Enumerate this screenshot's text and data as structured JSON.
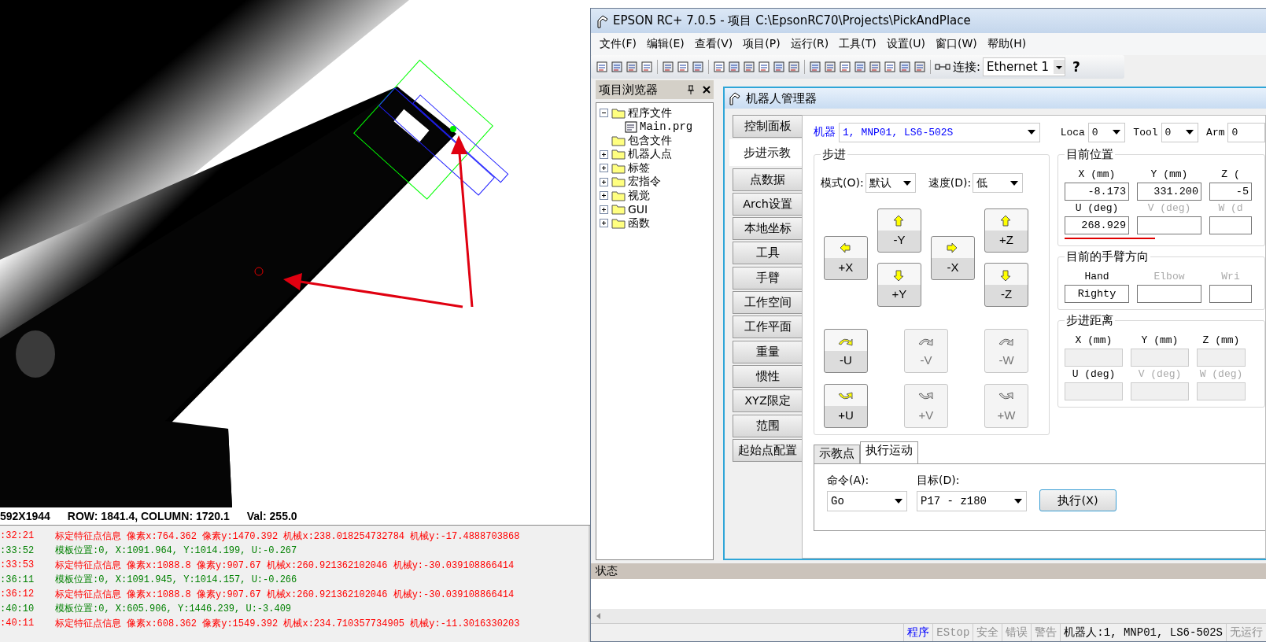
{
  "camera_view": {
    "info": [
      "592X1944",
      "ROW: 1841.4, COLUMN: 1720.1",
      "Val: 255.0"
    ]
  },
  "log": [
    {
      "time": ":32:21",
      "text": "标定特征点信息 像素x:764.362 像素y:1470.392 机械x:238.018254732784 机械y:-17.4888703868",
      "color": "#ff0000"
    },
    {
      "time": ":33:52",
      "text": "模板位置:0, X:1091.964, Y:1014.199, U:-0.267",
      "color": "#008000"
    },
    {
      "time": ":33:53",
      "text": "标定特征点信息 像素x:1088.8 像素y:907.67 机械x:260.921362102046 机械y:-30.039108866414",
      "color": "#ff0000"
    },
    {
      "time": ":36:11",
      "text": "模板位置:0, X:1091.945, Y:1014.157, U:-0.266",
      "color": "#008000"
    },
    {
      "time": ":36:12",
      "text": "标定特征点信息 像素x:1088.8 像素y:907.67 机械x:260.921362102046 机械y:-30.039108866414",
      "color": "#ff0000"
    },
    {
      "time": ":40:10",
      "text": "模板位置:0, X:605.906, Y:1446.239, U:-3.409",
      "color": "#008000"
    },
    {
      "time": ":40:11",
      "text": "标定特征点信息 像素x:608.362 像素y:1549.392 机械x:234.710357734905 机械y:-11.3016330203",
      "color": "#ff0000"
    }
  ],
  "window": {
    "title": "EPSON RC+ 7.0.5 - 项目 C:\\EpsonRC70\\Projects\\PickAndPlace"
  },
  "menu": [
    "文件(F)",
    "编辑(E)",
    "查看(V)",
    "项目(P)",
    "运行(R)",
    "工具(T)",
    "设置(U)",
    "窗口(W)",
    "帮助(H)"
  ],
  "toolbar": {
    "connection_label": "连接:",
    "connection": "Ethernet 1",
    "help": "?"
  },
  "project_browser": {
    "title": "项目浏览器",
    "tree": [
      {
        "label": "程序文件",
        "expanded": true,
        "kind": "folder",
        "children": [
          {
            "label": "Main.prg",
            "kind": "file"
          }
        ]
      },
      {
        "label": "包含文件",
        "kind": "folder"
      },
      {
        "label": "机器人点",
        "expanded": false,
        "kind": "folder"
      },
      {
        "label": "标签",
        "expanded": false,
        "kind": "folder"
      },
      {
        "label": "宏指令",
        "expanded": false,
        "kind": "folder"
      },
      {
        "label": "视觉",
        "expanded": false,
        "kind": "folder"
      },
      {
        "label": "GUI",
        "expanded": false,
        "kind": "folder"
      },
      {
        "label": "函数",
        "expanded": false,
        "kind": "folder"
      }
    ]
  },
  "robot_manager": {
    "title": "机器人管理器",
    "tabs": [
      {
        "label": "控制面板",
        "selected": false
      },
      {
        "label": "步进示教",
        "selected": true
      },
      {
        "label": "点数据",
        "selected": false
      },
      {
        "label": "Arch设置",
        "selected": false
      },
      {
        "label": "本地坐标",
        "selected": false
      },
      {
        "label": "工具",
        "selected": false
      },
      {
        "label": "手臂",
        "selected": false
      },
      {
        "label": "工作空间",
        "selected": false
      },
      {
        "label": "工作平面",
        "selected": false
      },
      {
        "label": "重量",
        "selected": false
      },
      {
        "label": "惯性",
        "selected": false
      },
      {
        "label": "XYZ限定",
        "selected": false
      },
      {
        "label": "范围",
        "selected": false
      },
      {
        "label": "起始点配置",
        "selected": false
      }
    ],
    "robot_label": "机器",
    "robot": "1, MNP01, LS6-502S",
    "selectors": [
      {
        "label": "Loca",
        "value": "0"
      },
      {
        "label": "Tool",
        "value": "0"
      },
      {
        "label": "Arm",
        "value": "0"
      }
    ],
    "jog": {
      "title": "步进",
      "mode_label": "模式(O):",
      "mode": "默认",
      "speed_label": "速度(D):",
      "speed": "低",
      "columns": [
        [
          {
            "label": "+X",
            "kind": "left",
            "enabled": true
          }
        ],
        [
          {
            "label": "-Y",
            "kind": "up",
            "enabled": true
          },
          {
            "label": "+Y",
            "kind": "down",
            "enabled": true
          }
        ],
        [
          {
            "label": "-X",
            "kind": "right",
            "enabled": true
          }
        ],
        [
          {
            "label": "+Z",
            "kind": "up",
            "enabled": true
          },
          {
            "label": "-Z",
            "kind": "down",
            "enabled": true
          }
        ]
      ],
      "rotation_rows": [
        [
          {
            "label": "-U",
            "kind": "rotate",
            "enabled": true
          },
          {
            "label": "-V",
            "kind": "rotate",
            "enabled": false
          },
          {
            "label": "-W",
            "kind": "rotate",
            "enabled": false
          }
        ],
        [
          {
            "label": "+U",
            "kind": "rotate_back",
            "enabled": true
          },
          {
            "label": "+V",
            "kind": "rotate_back",
            "enabled": false
          },
          {
            "label": "+W",
            "kind": "rotate_back",
            "enabled": false
          }
        ]
      ]
    },
    "current_position": {
      "title": "目前位置",
      "fields": [
        {
          "label": "X (mm)",
          "value": "-8.173",
          "enabled": true
        },
        {
          "label": "Y (mm)",
          "value": "331.200",
          "enabled": true
        },
        {
          "label": "Z (",
          "value": "-5",
          "enabled": true
        },
        {
          "label": "U (deg)",
          "value": "268.929",
          "enabled": true
        },
        {
          "label": "V (deg)",
          "enabled": false
        },
        {
          "label": "W (d",
          "enabled": false
        }
      ]
    },
    "arm_orientation": {
      "title": "目前的手臂方向",
      "fields": [
        {
          "label": "Hand",
          "value": "Righty",
          "enabled": true
        },
        {
          "label": "Elbow",
          "enabled": false
        },
        {
          "label": "Wri",
          "enabled": false
        }
      ]
    },
    "step_distance": {
      "title": "步进距离",
      "fields": [
        {
          "label": "X (mm)",
          "enabled": true
        },
        {
          "label": "Y (mm)",
          "enabled": true
        },
        {
          "label": "Z (mm)",
          "enabled": true
        },
        {
          "label": "U (deg)",
          "enabled": true
        },
        {
          "label": "V (deg)",
          "enabled": false
        },
        {
          "label": "W (deg)",
          "enabled": false
        }
      ]
    },
    "lower_tabs": [
      {
        "label": "示教点",
        "selected": false
      },
      {
        "label": "执行运动",
        "selected": true
      }
    ],
    "execute": {
      "command_label": "命令(A):",
      "command": "Go",
      "target_label": "目标(D):",
      "target": "P17 - z180",
      "button": "执行(X)"
    }
  },
  "status_panel": {
    "title": "状态"
  },
  "status_bar": [
    {
      "text": "程序",
      "kind": "mode"
    },
    {
      "text": "EStop",
      "kind": "indicator"
    },
    {
      "text": "安全",
      "kind": "indicator"
    },
    {
      "text": "错误",
      "kind": "indicator"
    },
    {
      "text": "警告",
      "kind": "indicator"
    },
    {
      "text": "机器人:1, MNP01, LS6-502S",
      "kind": "info"
    },
    {
      "text": "无运行",
      "kind": "indicator"
    }
  ]
}
